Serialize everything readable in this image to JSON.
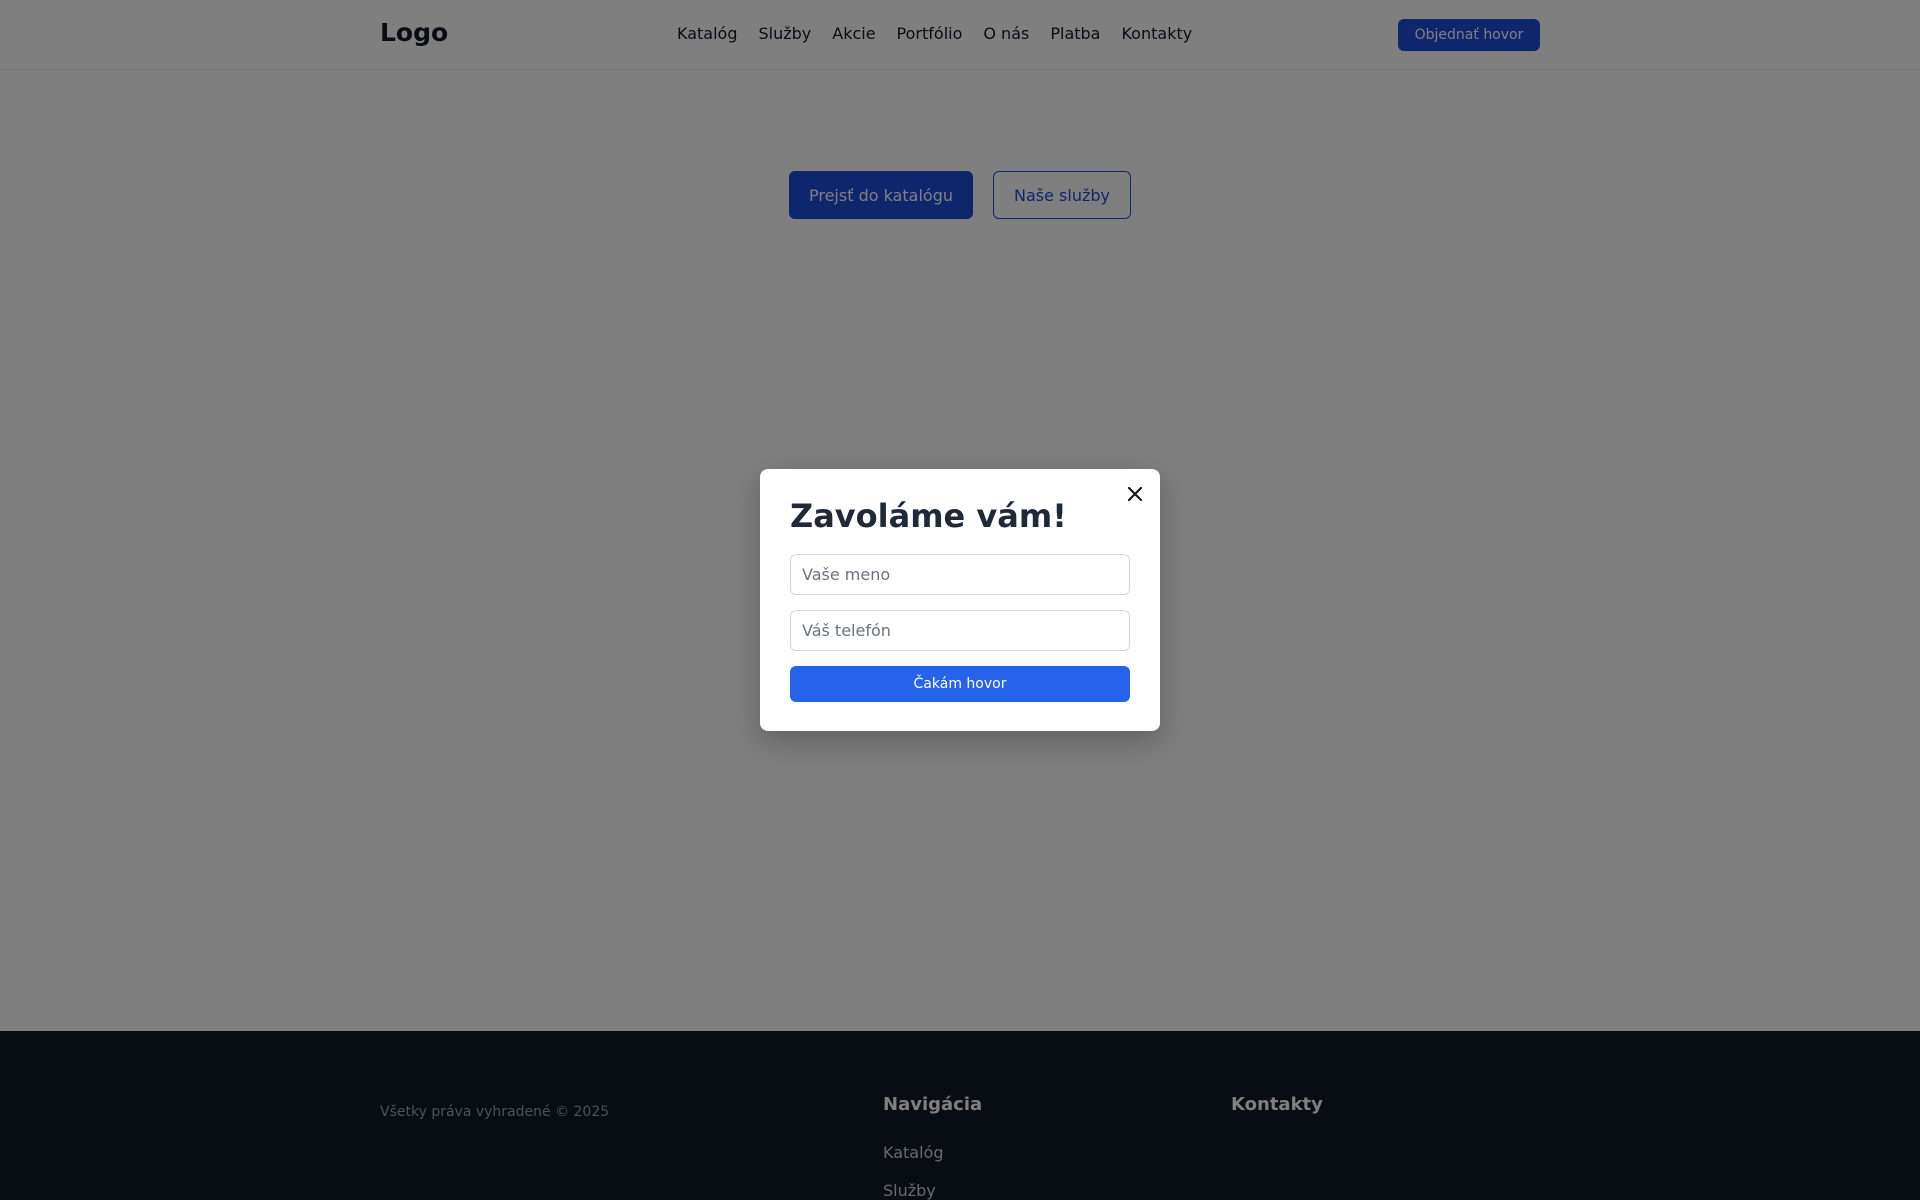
{
  "header": {
    "logo": "Logo",
    "nav": [
      "Katalóg",
      "Služby",
      "Akcie",
      "Portfólio",
      "O nás",
      "Platba",
      "Kontakty"
    ],
    "order_call_label": "Objednať hovor"
  },
  "hero": {
    "catalog_button": "Prejsť do katalógu",
    "services_button": "Naše služby"
  },
  "modal": {
    "title": "Zavoláme vám!",
    "name_placeholder": "Vaše meno",
    "phone_placeholder": "Váš telefón",
    "submit_label": "Čakám hovor",
    "close_icon": "close-icon"
  },
  "footer": {
    "copyright": "Všetky práva vyhradené © 2025",
    "nav_heading": "Navigácia",
    "contacts_heading": "Kontakty",
    "nav_links": [
      "Katalóg",
      "Služby"
    ]
  },
  "colors": {
    "primary": "#1d4ed8",
    "submit": "#2563eb",
    "footer_bg": "#111827"
  }
}
